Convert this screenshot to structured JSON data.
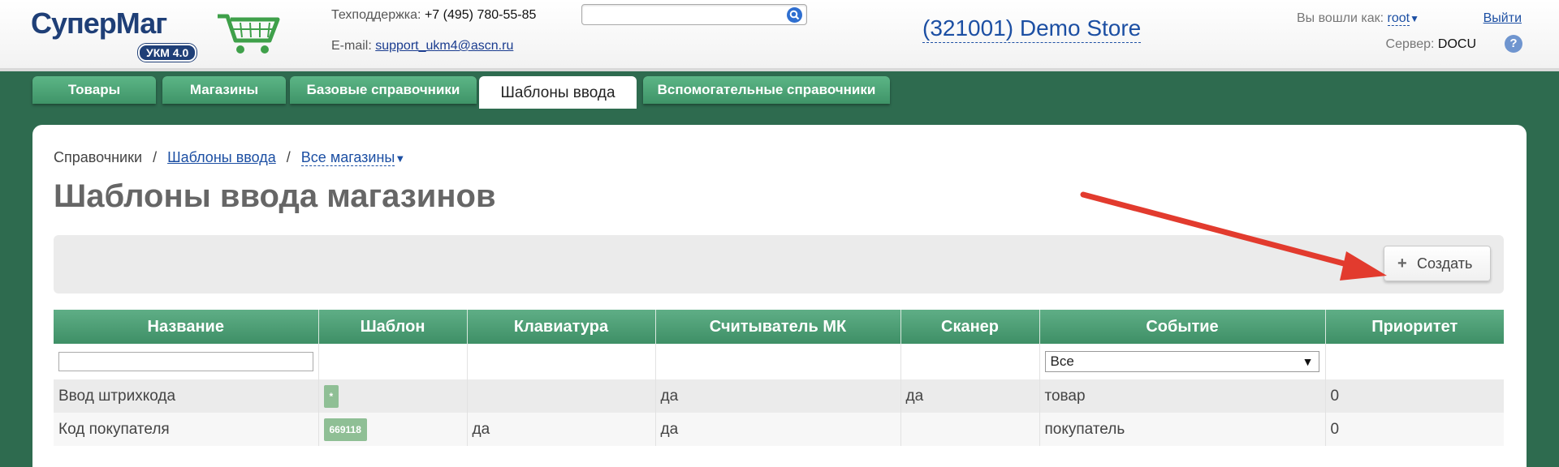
{
  "header": {
    "logo_text_1": "Супер",
    "logo_text_2": "Маг",
    "logo_badge": "УКМ 4.0",
    "support_label": "Техподдержка:",
    "support_phone": "+7 (495) 780-55-85",
    "email_label": "E-mail:",
    "email_value": "support_ukm4@ascn.ru",
    "search_value": "",
    "store_title": "(321001) Demo Store",
    "login_label": "Вы вошли как:",
    "login_user": "root",
    "logout_label": "Выйти",
    "server_label": "Сервер:",
    "server_value": "DOCU",
    "help_label": "?"
  },
  "tabs": [
    {
      "label": "Товары",
      "active": false
    },
    {
      "label": "Магазины",
      "active": false
    },
    {
      "label": "Базовые справочники",
      "active": false
    },
    {
      "label": "Шаблоны ввода",
      "active": true
    },
    {
      "label": "Вспомогательные справочники",
      "active": false
    }
  ],
  "breadcrumb": {
    "root": "Справочники",
    "separator": "/",
    "link": "Шаблоны ввода",
    "dropdown": "Все магазины"
  },
  "page_title": "Шаблоны ввода магазинов",
  "toolbar": {
    "create_label": "Создать"
  },
  "table": {
    "columns": [
      "Название",
      "Шаблон",
      "Клавиатура",
      "Считыватель МК",
      "Сканер",
      "Событие",
      "Приоритет"
    ],
    "filter": {
      "name_value": "",
      "event_value": "Все"
    },
    "rows": [
      {
        "name": "Ввод штрихкода",
        "pattern": "*",
        "keyboard": "",
        "card_reader": "да",
        "scanner": "да",
        "event": "товар",
        "priority": "0"
      },
      {
        "name": "Код покупателя",
        "pattern": "669118",
        "keyboard": "да",
        "card_reader": "да",
        "scanner": "",
        "event": "покупатель",
        "priority": "0"
      }
    ]
  },
  "colors": {
    "brand_green": "#2e6b4f",
    "tab_green": "#4fa577",
    "link_blue": "#1c4fa3",
    "annotation_red": "#e23b2e"
  }
}
